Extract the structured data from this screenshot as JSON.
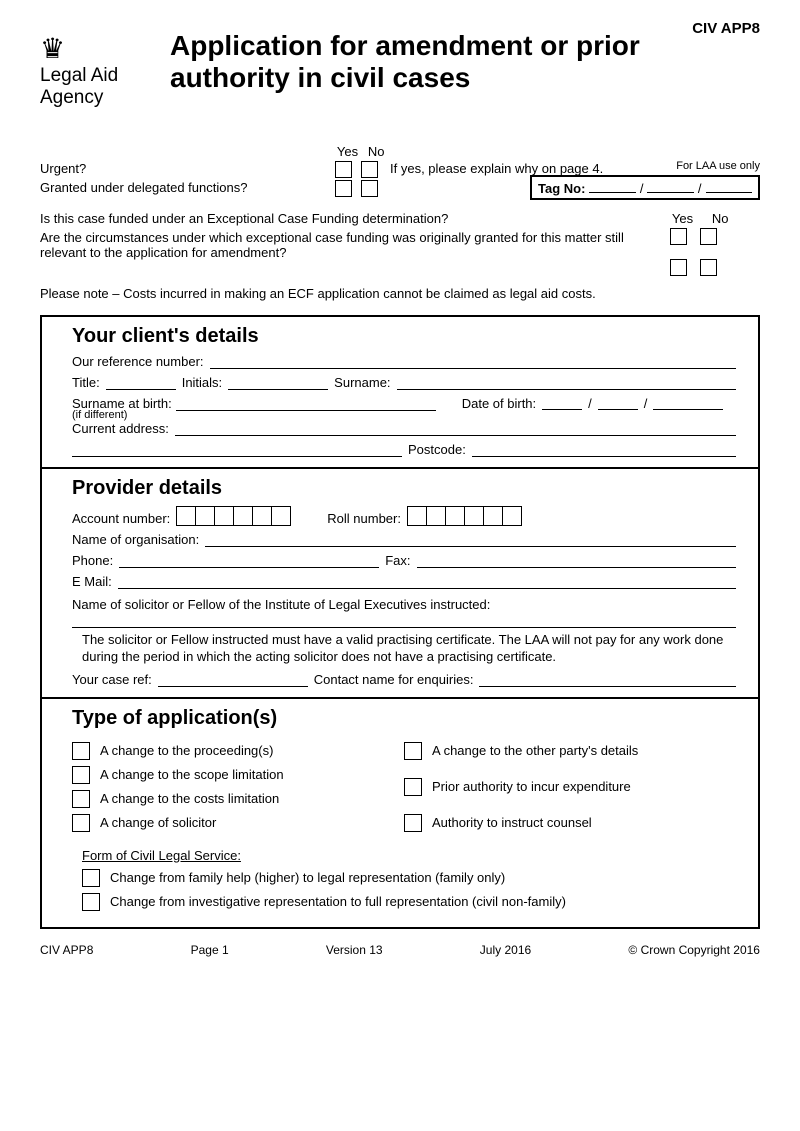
{
  "form_code": "CIV APP8",
  "agency": "Legal Aid Agency",
  "title": "Application for amendment or prior authority in civil cases",
  "laa_use": "For LAA use only",
  "tag_label": "Tag No:",
  "yes": "Yes",
  "no": "No",
  "urgent_label": "Urgent?",
  "urgent_note": "If yes, please explain why on page 4.",
  "delegated_label": "Granted under delegated functions?",
  "ecf_q1": "Is this case funded under an Exceptional Case Funding determination?",
  "ecf_q2": "Are the circumstances under which exceptional case funding was originally granted for this matter still relevant to the application for amendment?",
  "note": "Please note – Costs incurred in making an ECF application cannot be claimed as legal aid costs.",
  "client": {
    "title": "Your client's details",
    "ref": "Our reference number:",
    "t": "Title:",
    "initials": "Initials:",
    "surname": "Surname:",
    "birth_surname": "Surname at birth:",
    "ifdiff": "(if different)",
    "dob": "Date of birth:",
    "addr": "Current address:",
    "postcode": "Postcode:"
  },
  "provider": {
    "title": "Provider details",
    "account": "Account number:",
    "roll": "Roll number:",
    "org": "Name of organisation:",
    "phone": "Phone:",
    "fax": "Fax:",
    "email": "E Mail:",
    "solic": "Name of solicitor or Fellow of the Institute of Legal Executives instructed:",
    "note": "The solicitor or Fellow instructed must have a valid practising certificate. The LAA will not pay for any work done during the period in which the acting solicitor does not have a practising certificate.",
    "caseref": "Your case ref:",
    "contact": "Contact name for enquiries:"
  },
  "apps": {
    "title": "Type of application(s)",
    "a1": "A change to the proceeding(s)",
    "a2": "A change to the scope limitation",
    "a3": "A change to the costs  limitation",
    "a4": "A change of solicitor",
    "b1": "A change to the other party's details",
    "b2": "Prior authority to incur expenditure",
    "b3": "Authority to instruct counsel",
    "civil": "Form of Civil Legal Service:",
    "c1": "Change from family help (higher) to legal representation (family only)",
    "c2": "Change from investigative representation to full representation (civil non-family)"
  },
  "footer": {
    "f1": "CIV APP8",
    "f2": "Page 1",
    "f3": "Version 13",
    "f4": "July 2016",
    "f5": "© Crown Copyright 2016"
  }
}
